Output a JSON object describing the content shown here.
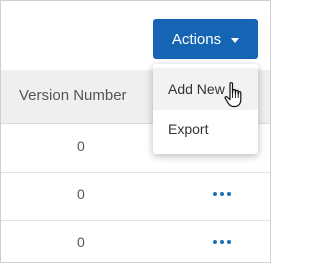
{
  "toolbar": {
    "actions_label": "Actions"
  },
  "actions_menu": {
    "items": [
      {
        "label": "Add New"
      },
      {
        "label": "Export"
      }
    ]
  },
  "table": {
    "columns": [
      "Version Number"
    ],
    "rows": [
      {
        "version": "0"
      },
      {
        "version": "0"
      },
      {
        "version": "0"
      }
    ]
  },
  "icons": {
    "row_action": "more-horizontal-icon",
    "dropdown": "caret-down-icon",
    "pointer": "hand-pointer-icon"
  },
  "colors": {
    "accent": "#1565b4",
    "dots": "#1f6fb5",
    "header_bg": "#efefef"
  }
}
